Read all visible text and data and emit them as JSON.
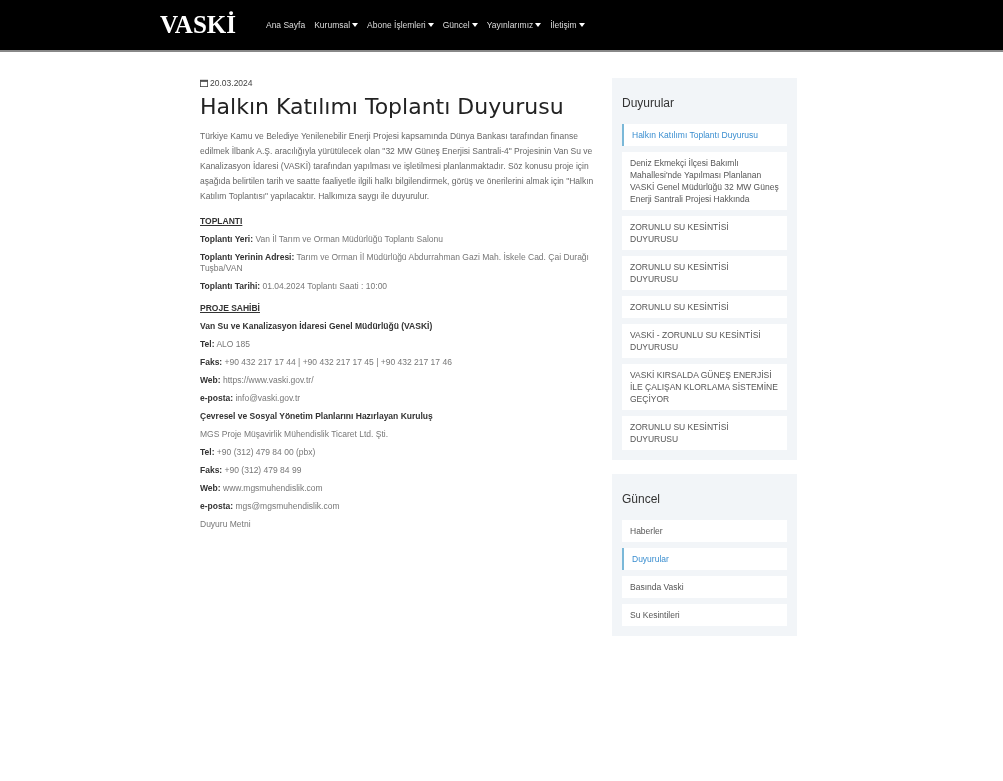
{
  "header": {
    "logo": "VASKİ",
    "nav": [
      {
        "label": "Ana Sayfa",
        "dropdown": false
      },
      {
        "label": "Kurumsal",
        "dropdown": true
      },
      {
        "label": "Abone İşlemleri",
        "dropdown": true
      },
      {
        "label": "Güncel",
        "dropdown": true
      },
      {
        "label": "Yayınlarımız",
        "dropdown": true
      },
      {
        "label": "İletişim",
        "dropdown": true
      }
    ]
  },
  "article": {
    "date": "20.03.2024",
    "title": "Halkın Katılımı Toplantı Duyurusu",
    "blocks": [
      {
        "kind": "paragraph",
        "text": "Türkiye Kamu ve Belediye Yenilenebilir Enerji Projesi kapsamında Dünya Bankası tarafından finanse edilmek İlbank A.Ş. aracılığıyla yürütülecek olan \"32 MW Güneş Enerjisi Santrali-4\" Projesinin Van Su ve Kanalizasyon İdaresi (VASKİ) tarafından yapılması ve işletilmesi planlanmaktadır. Söz konusu proje için aşağıda belirtilen tarih ve saatte faaliyetle ilgili halkı bilgilendirmek, görüş ve önerilerini almak için \"Halkın Katılım Toplantısı\" yapılacaktır. Halkımıza saygı ile duyurulur."
      },
      {
        "kind": "heading",
        "text": "TOPLANTI"
      },
      {
        "kind": "line",
        "text": "**Toplantı Yeri:** Van İl Tarım ve Orman Müdürlüğü Toplantı Salonu"
      },
      {
        "kind": "line",
        "text": "**Toplantı Yerinin Adresi:** Tarım ve Orman İl Müdürlüğü Abdurrahman Gazi Mah. İskele Cad. Çai Durağı Tuşba/VAN"
      },
      {
        "kind": "line",
        "text": "**Toplantı Tarihi:** 01.04.2024 Toplantı Saati : 10:00"
      },
      {
        "kind": "heading",
        "text": "PROJE SAHİBİ"
      },
      {
        "kind": "strong",
        "text": "Van Su ve Kanalizasyon İdaresi Genel Müdürlüğü (VASKİ)"
      },
      {
        "kind": "line",
        "text": "**Tel:** ALO 185"
      },
      {
        "kind": "line",
        "text": "**Faks:** +90 432 217 17 44 | +90 432 217 17 45 | +90 432 217 17 46"
      },
      {
        "kind": "line",
        "text": "**Web:** https://www.vaski.gov.tr/"
      },
      {
        "kind": "line",
        "text": "**e-posta:** info@vaski.gov.tr"
      },
      {
        "kind": "strong",
        "text": "Çevresel ve Sosyal Yönetim Planlarını Hazırlayan Kuruluş"
      },
      {
        "kind": "line",
        "text": "MGS Proje Müşavirlik Mühendislik Ticaret Ltd. Şti."
      },
      {
        "kind": "line",
        "text": "**Tel:** +90 (312) 479 84 00 (pbx)"
      },
      {
        "kind": "line",
        "text": "**Faks:** +90 (312) 479 84 99"
      },
      {
        "kind": "line",
        "text": "**Web:** www.mgsmuhendislik.com"
      },
      {
        "kind": "line",
        "text": "**e-posta:** mgs@mgsmuhendislik.com"
      },
      {
        "kind": "line",
        "text": "Duyuru Metni"
      }
    ]
  },
  "sidebar": [
    {
      "title": "Duyurular",
      "items": [
        {
          "label": "Halkın Katılımı Toplantı Duyurusu",
          "selected": true
        },
        {
          "label": "Deniz Ekmekçi İlçesi Bakımlı Mahallesi'nde Yapılması Planlanan VASKİ Genel Müdürlüğü 32 MW Güneş Enerji Santrali Projesi Hakkında",
          "selected": false
        },
        {
          "label": "ZORUNLU SU KESİNTİSİ DUYURUSU",
          "selected": false
        },
        {
          "label": "ZORUNLU SU KESİNTİSİ DUYURUSU",
          "selected": false
        },
        {
          "label": "ZORUNLU SU KESİNTİSİ",
          "selected": false
        },
        {
          "label": "VASKİ - ZORUNLU SU KESİNTİSİ DUYURUSU",
          "selected": false
        },
        {
          "label": "VASKİ KIRSALDA GÜNEŞ ENERJİSİ İLE ÇALIŞAN KLORLAMA SİSTEMİNE GEÇİYOR",
          "selected": false
        },
        {
          "label": "ZORUNLU SU KESİNTİSİ DUYURUSU",
          "selected": false
        }
      ]
    },
    {
      "title": "Güncel",
      "items": [
        {
          "label": "Haberler",
          "selected": false
        },
        {
          "label": "Duyurular",
          "selected": true
        },
        {
          "label": "Basında Vaski",
          "selected": false
        },
        {
          "label": "Su Kesintileri",
          "selected": false
        }
      ]
    }
  ]
}
